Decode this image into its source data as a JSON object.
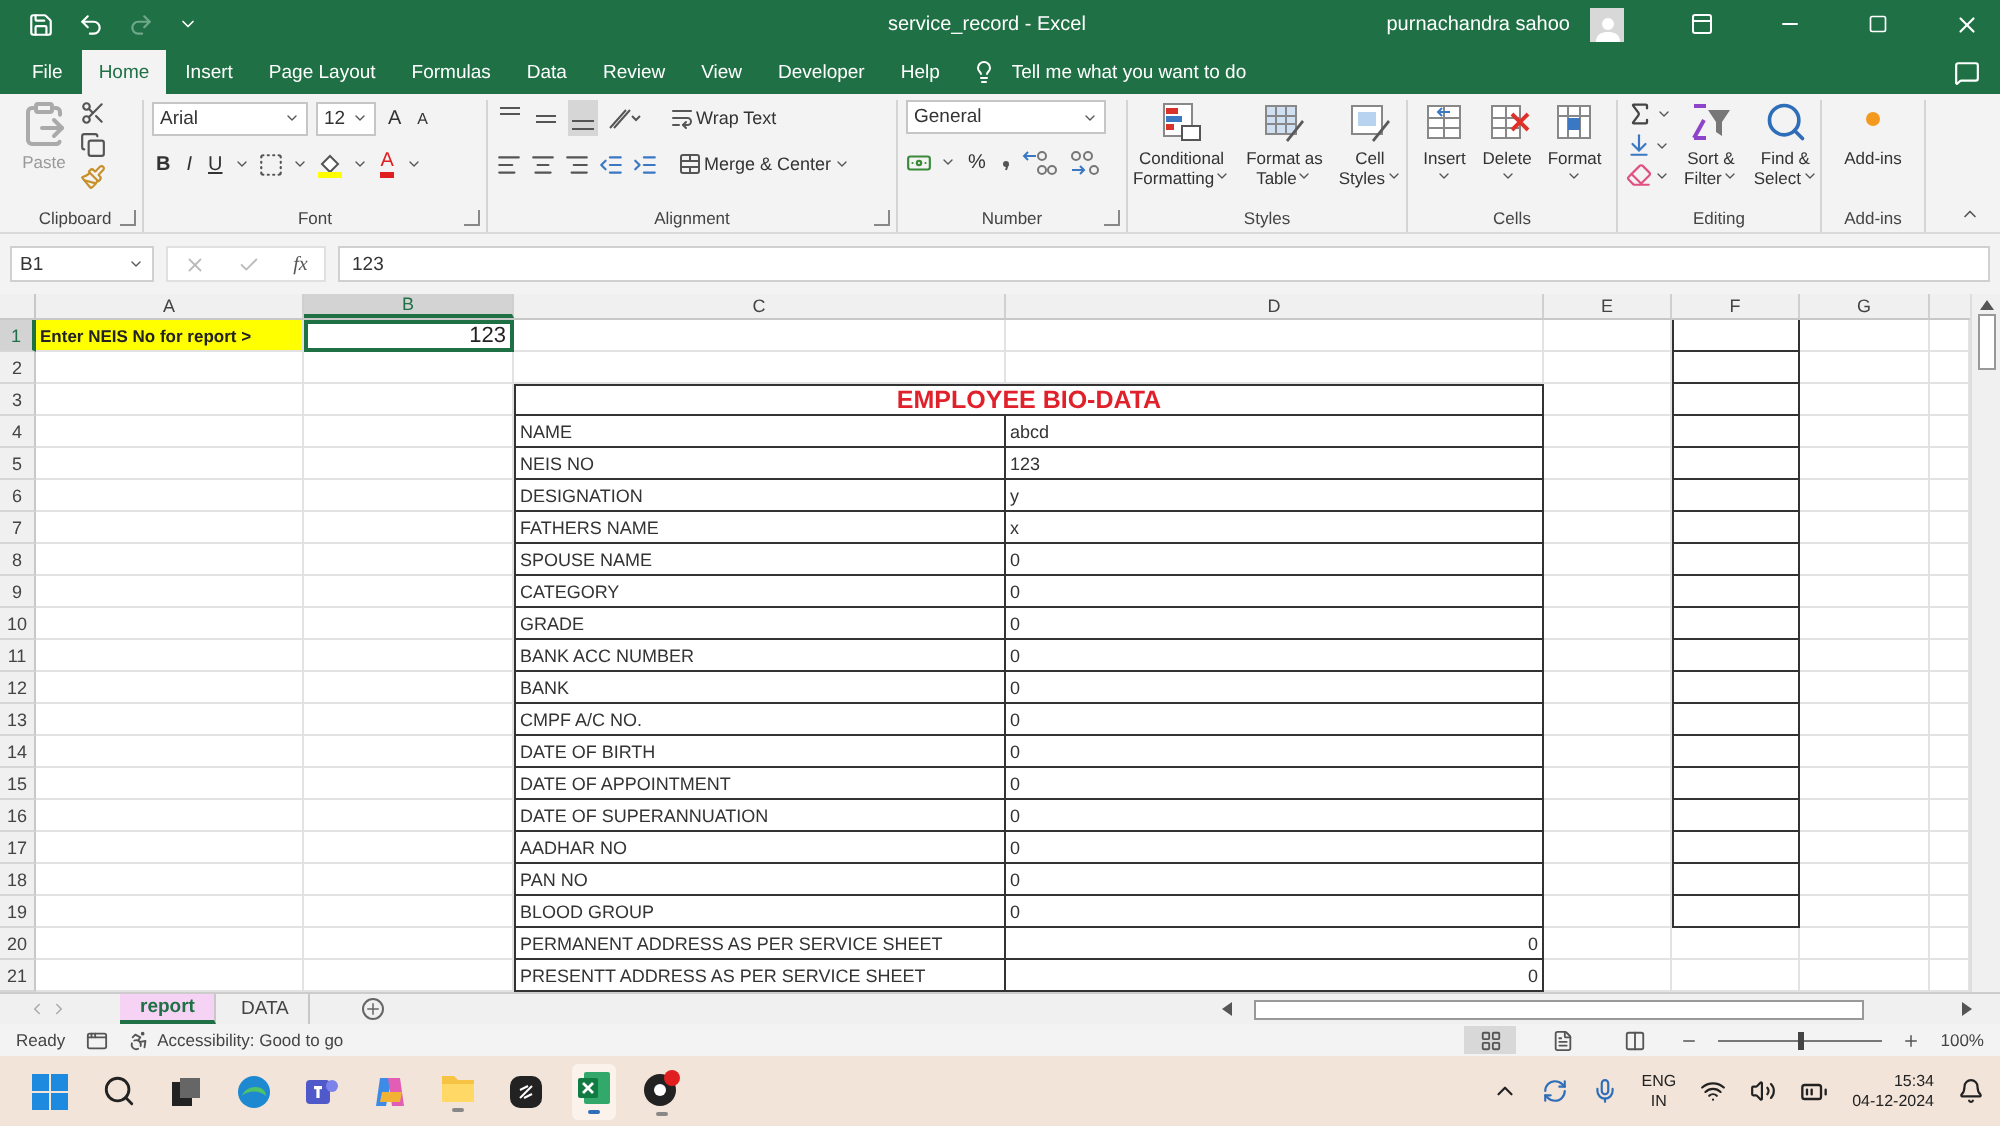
{
  "title_bar": {
    "title": "service_record  -  Excel",
    "user": "purnachandra sahoo"
  },
  "menu_tabs": [
    {
      "label": "File",
      "selected": false
    },
    {
      "label": "Home",
      "selected": true
    },
    {
      "label": "Insert",
      "selected": false
    },
    {
      "label": "Page Layout",
      "selected": false
    },
    {
      "label": "Formulas",
      "selected": false
    },
    {
      "label": "Data",
      "selected": false
    },
    {
      "label": "Review",
      "selected": false
    },
    {
      "label": "View",
      "selected": false
    },
    {
      "label": "Developer",
      "selected": false
    },
    {
      "label": "Help",
      "selected": false
    }
  ],
  "tell_me": "Tell me what you want to do",
  "ribbon": {
    "groups": [
      {
        "kind": "clipboard",
        "label": "Clipboard",
        "launcher": true,
        "paste": "Paste"
      },
      {
        "kind": "font",
        "label": "Font",
        "launcher": true,
        "font_name": "Arial",
        "font_size": "12",
        "grow": "A",
        "shrink": "A",
        "bold": "B",
        "italic": "I",
        "underline": "U",
        "font_color": "A"
      },
      {
        "kind": "alignment",
        "label": "Alignment",
        "launcher": true,
        "wrap_text": "Wrap Text",
        "merge_center": "Merge & Center"
      },
      {
        "kind": "number",
        "label": "Number",
        "launcher": true,
        "format": "General",
        "percent": "%"
      },
      {
        "kind": "buttons",
        "label": "Styles",
        "launcher": false,
        "buttons": [
          {
            "kind": "conditional",
            "lines": [
              "Conditional",
              "Formatting"
            ],
            "dropdown": true
          },
          {
            "kind": "table",
            "lines": [
              "Format as",
              "Table"
            ],
            "dropdown": true
          },
          {
            "kind": "cell_styles",
            "lines": [
              "Cell",
              "Styles"
            ],
            "dropdown": true
          }
        ]
      },
      {
        "kind": "buttons",
        "label": "Cells",
        "launcher": false,
        "buttons": [
          {
            "kind": "insert",
            "lines": [
              "Insert"
            ],
            "dropdown": true
          },
          {
            "kind": "delete",
            "lines": [
              "Delete"
            ],
            "dropdown": true
          },
          {
            "kind": "format",
            "lines": [
              "Format"
            ],
            "dropdown": true
          }
        ]
      },
      {
        "kind": "editing",
        "label": "Editing",
        "launcher": false,
        "buttons": [
          {
            "kind": "sort",
            "lines": [
              "Sort &",
              "Filter"
            ],
            "dropdown": true
          },
          {
            "kind": "find",
            "lines": [
              "Find &",
              "Select"
            ],
            "dropdown": true
          }
        ]
      },
      {
        "kind": "buttons",
        "label": "Add-ins",
        "launcher": false,
        "buttons": [
          {
            "kind": "addins",
            "lines": [
              "Add-ins"
            ],
            "dropdown": false
          }
        ]
      }
    ]
  },
  "formula_bar": {
    "name_box": "B1",
    "function_label": "fx",
    "value": "123"
  },
  "sheet": {
    "columns": [
      {
        "label": "A",
        "selected": false
      },
      {
        "label": "B",
        "selected": true
      },
      {
        "label": "C",
        "selected": false
      },
      {
        "label": "D",
        "selected": false
      },
      {
        "label": "E",
        "selected": false
      },
      {
        "label": "F",
        "selected": false
      },
      {
        "label": "G",
        "selected": false
      }
    ],
    "rows": [
      {
        "label": "1",
        "selected": true
      },
      {
        "label": "2",
        "selected": false
      },
      {
        "label": "3",
        "selected": false
      },
      {
        "label": "4",
        "selected": false
      },
      {
        "label": "5",
        "selected": false
      },
      {
        "label": "6",
        "selected": false
      },
      {
        "label": "7",
        "selected": false
      },
      {
        "label": "8",
        "selected": false
      },
      {
        "label": "9",
        "selected": false
      },
      {
        "label": "10",
        "selected": false
      },
      {
        "label": "11",
        "selected": false
      },
      {
        "label": "12",
        "selected": false
      },
      {
        "label": "13",
        "selected": false
      },
      {
        "label": "14",
        "selected": false
      },
      {
        "label": "15",
        "selected": false
      },
      {
        "label": "16",
        "selected": false
      },
      {
        "label": "17",
        "selected": false
      },
      {
        "label": "18",
        "selected": false
      },
      {
        "label": "19",
        "selected": false
      },
      {
        "label": "20",
        "selected": false
      },
      {
        "label": "21",
        "selected": false
      }
    ],
    "prompt": "Enter NEIS No for report >",
    "input": {
      "value": "123",
      "selected": true
    },
    "report": {
      "title": "EMPLOYEE BIO-DATA",
      "fields": [
        {
          "label": "NAME",
          "value": "abcd",
          "kind": "text"
        },
        {
          "label": "NEIS NO",
          "value": "123",
          "kind": "text"
        },
        {
          "label": "DESIGNATION",
          "value": "y",
          "kind": "text"
        },
        {
          "label": "FATHERS NAME",
          "value": "x",
          "kind": "text"
        },
        {
          "label": "SPOUSE NAME",
          "value": "0",
          "kind": "text"
        },
        {
          "label": "CATEGORY",
          "value": "0",
          "kind": "text"
        },
        {
          "label": "GRADE",
          "value": "0",
          "kind": "text"
        },
        {
          "label": "BANK ACC NUMBER",
          "value": "0",
          "kind": "text"
        },
        {
          "label": "BANK",
          "value": "0",
          "kind": "text"
        },
        {
          "label": "CMPF A/C NO.",
          "value": "0",
          "kind": "text"
        },
        {
          "label": "DATE OF BIRTH",
          "value": "0",
          "kind": "text"
        },
        {
          "label": "DATE OF APPOINTMENT",
          "value": "0",
          "kind": "text"
        },
        {
          "label": "DATE OF SUPERANNUATION",
          "value": "0",
          "kind": "text"
        },
        {
          "label": "AADHAR NO",
          "value": "0",
          "kind": "text"
        },
        {
          "label": "PAN NO",
          "value": "0",
          "kind": "text"
        },
        {
          "label": "BLOOD GROUP",
          "value": "0",
          "kind": "text"
        },
        {
          "label": "PERMANENT ADDRESS AS PER SERVICE SHEET",
          "value": "0",
          "kind": "number"
        },
        {
          "label": "PRESENTT ADDRESS AS PER SERVICE SHEET",
          "value": "0",
          "kind": "number"
        }
      ]
    }
  },
  "sheet_tabs": [
    {
      "label": "report",
      "selected": true
    },
    {
      "label": "DATA",
      "selected": false
    }
  ],
  "status_bar": {
    "mode": "Ready",
    "accessibility": "Accessibility: Good to go",
    "zoom": {
      "level": 0.5,
      "reading": "100%"
    }
  },
  "taskbar": {
    "language": "ENG",
    "region": "IN",
    "time": "15:34",
    "date": "04-12-2024"
  }
}
